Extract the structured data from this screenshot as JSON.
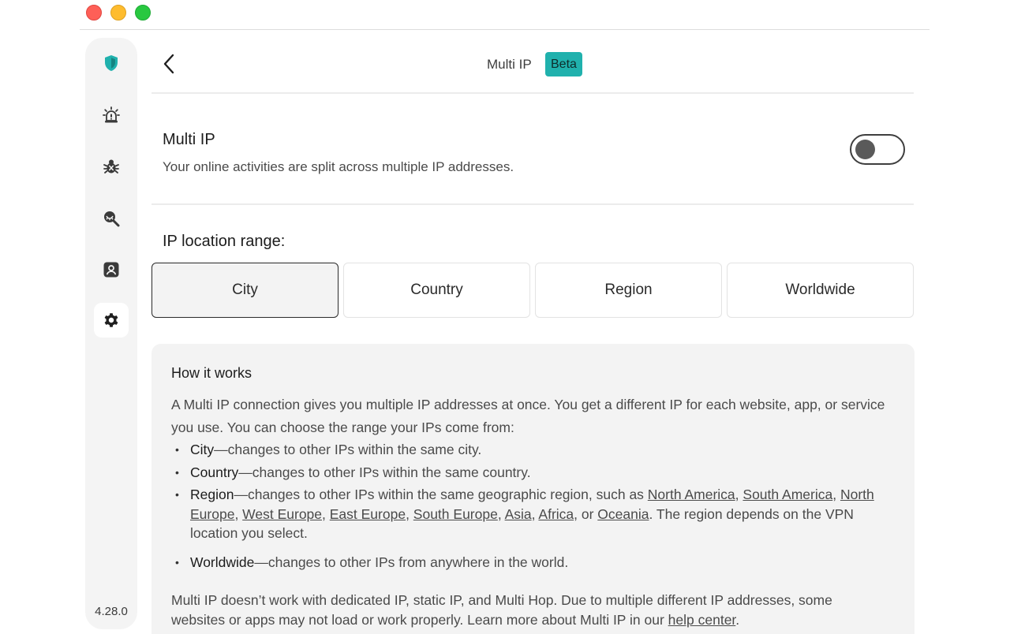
{
  "window": {
    "controls": [
      "close",
      "minimize",
      "zoom"
    ]
  },
  "sidebar": {
    "items": [
      {
        "name": "shield-icon",
        "active": false
      },
      {
        "name": "alarm-icon",
        "active": false
      },
      {
        "name": "bug-icon",
        "active": false
      },
      {
        "name": "dark-web-monitor-icon",
        "active": false
      },
      {
        "name": "account-icon",
        "active": false
      },
      {
        "name": "gear-icon",
        "active": true
      }
    ],
    "version": "4.28.0"
  },
  "header": {
    "title": "Multi IP",
    "badge": "Beta"
  },
  "multi_ip": {
    "title": "Multi IP",
    "description": "Your online activities are split across multiple IP addresses.",
    "enabled": false
  },
  "range": {
    "label": "IP location range:",
    "options": [
      "City",
      "Country",
      "Region",
      "Worldwide"
    ],
    "selected": "City"
  },
  "how": {
    "title": "How it works",
    "intro": "A Multi IP connection gives you multiple IP addresses at once. You get a different IP for each website, app, or service you use. You can choose the range your IPs come from:",
    "city": {
      "term": "City",
      "text": "—changes to other IPs within the same city."
    },
    "country": {
      "term": "Country",
      "text": "—changes to other IPs within the same country."
    },
    "region": {
      "term": "Region",
      "text": "—changes to other IPs within the same geographic region, such as ",
      "links": [
        "North America",
        "South America",
        "North Europe",
        "West Europe",
        "East Europe",
        "South Europe",
        "Asia",
        "Africa",
        "Oceania"
      ],
      "sep": ", ",
      "or": ", or ",
      "tail": ". The region depends on the VPN location you select."
    },
    "worldwide": {
      "term": "Worldwide",
      "text": "—changes to other IPs from anywhere in the world."
    },
    "note": "Multi IP doesn’t work with dedicated IP, static IP, and Multi Hop. Due to multiple different IP addresses, some websites or apps may not load or work properly. Learn more about Multi IP in our ",
    "note_link": "help center",
    "note_end": "."
  },
  "colors": {
    "accent": "#20b1ad",
    "sidebar_bg": "#f4f4f4",
    "panel_bg": "#f3f3f3"
  }
}
